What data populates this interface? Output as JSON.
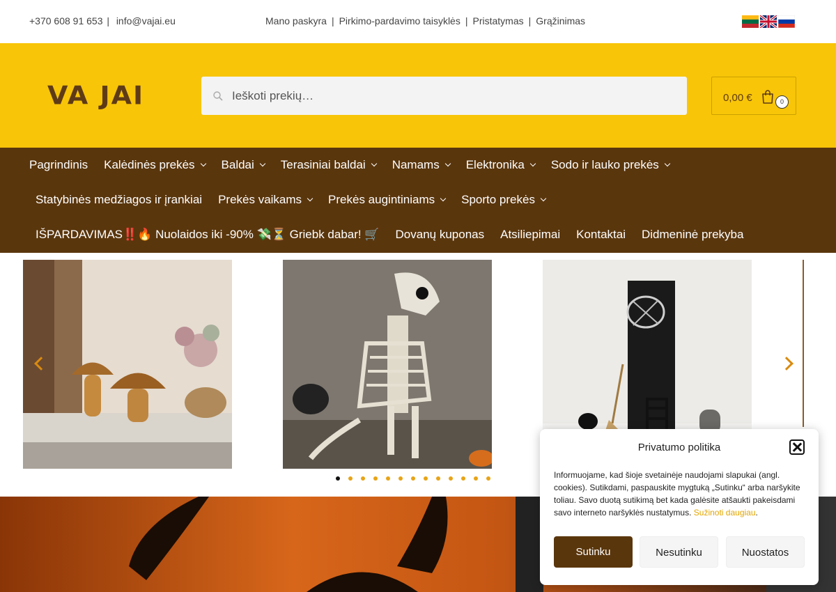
{
  "topbar": {
    "phone": "+370 608 91 653",
    "sep": "|",
    "email": "info@vajai.eu",
    "links": [
      "Mano paskyra",
      "Pirkimo-pardavimo taisyklės",
      "Pristatymas",
      "Grąžinimas"
    ],
    "languages": [
      "lt",
      "en",
      "ru"
    ]
  },
  "header": {
    "logo": "VA JAI",
    "search_placeholder": "Ieškoti prekių…",
    "cart_total": "0,00 €",
    "cart_count": "0"
  },
  "nav": {
    "row1": [
      {
        "label": "Pagrindinis",
        "dropdown": false
      },
      {
        "label": "Kalėdinės prekės",
        "dropdown": true
      },
      {
        "label": "Baldai",
        "dropdown": true
      },
      {
        "label": "Terasiniai baldai",
        "dropdown": true
      },
      {
        "label": "Namams",
        "dropdown": true
      },
      {
        "label": "Elektronika",
        "dropdown": true
      },
      {
        "label": "Sodo ir lauko prekės",
        "dropdown": true
      }
    ],
    "row2": [
      {
        "label": "Statybinės medžiagos ir įrankiai",
        "dropdown": false
      },
      {
        "label": "Prekės vaikams",
        "dropdown": true
      },
      {
        "label": "Prekės augintiniams",
        "dropdown": true
      },
      {
        "label": "Sporto prekės",
        "dropdown": true
      }
    ],
    "row3": [
      {
        "label": "IŠPARDAVIMAS‼️🔥 Nuolaidos iki -90% 💸⏳ Griebk dabar! 🛒",
        "dropdown": false
      },
      {
        "label": "Dovanų kuponas",
        "dropdown": false
      },
      {
        "label": "Atsiliepimai",
        "dropdown": false
      },
      {
        "label": "Kontaktai",
        "dropdown": false
      },
      {
        "label": "Didmeninė prekyba",
        "dropdown": false
      }
    ]
  },
  "carousel": {
    "slides": [
      "glass-mushroom-lamps",
      "skeleton-dog-decoration",
      "halloween-fairy-door"
    ],
    "dot_count": 13,
    "active_dot": 0
  },
  "cookie": {
    "title": "Privatumo politika",
    "text": "Informuojame, kad šioje svetainėje naudojami slapukai (angl. cookies). Sutikdami, paspauskite mygtuką „Sutinku“ arba naršykite toliau. Savo duotą sutikimą bet kada galėsite atšaukti pakeisdami savo interneto naršyklės nustatymus.",
    "more_link": "Sužinoti daugiau",
    "period": ".",
    "accept": "Sutinku",
    "deny": "Nesutinku",
    "settings": "Nuostatos"
  },
  "colors": {
    "accent_yellow": "#f8c508",
    "nav_brown": "#5a360d",
    "orange": "#d98a0f"
  }
}
